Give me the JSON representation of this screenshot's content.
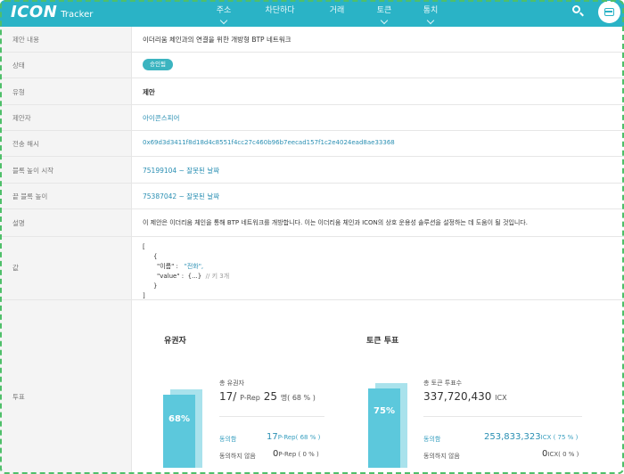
{
  "header": {
    "logo_main": "ICON",
    "logo_sub": "Tracker",
    "nav": [
      "주소",
      "차단하다",
      "거래",
      "토큰",
      "통치"
    ]
  },
  "rows": {
    "title": {
      "label": "제안 내용",
      "value": "이더리움 체인과의 연결을 위한 개방형 BTP 네트워크"
    },
    "status": {
      "label": "상태",
      "value": "승인됨"
    },
    "type": {
      "label": "유형",
      "value": "제안"
    },
    "proposer": {
      "label": "제안자",
      "value": "아이콘스피어"
    },
    "tx_hash": {
      "label": "전송 해시",
      "value": "0x69d3d3411f8d18d4c8551f4cc27c460b96b7eecad157f1c2e4024ead8ae33368"
    },
    "start_block": {
      "label": "블록 높이 시작",
      "value": "75199104",
      "suffix": " ~ 잘못된 날짜"
    },
    "end_block": {
      "label": "끝 블록 높이",
      "value": "75387042",
      "suffix": " ~ 잘못된 날짜"
    },
    "description": {
      "label": "설명",
      "value": "이 제안은 이더리움 체인을 통해 BTP 네트워크를 개방합니다. 이는 이더리움 체인과 ICON의 상호 운용성 솔루션을 설정하는 데 도움이 될 것입니다."
    },
    "value": {
      "label": "값",
      "open_bracket": "[",
      "open_brace": "{",
      "key1": "\"이름\" :",
      "val1": "\"전화\",",
      "key2": "\"value\" :",
      "val2": "{...}",
      "comment": "// 키 3개",
      "close_brace": "}",
      "close_bracket": "]"
    },
    "vote": {
      "label": "투표"
    }
  },
  "vote": {
    "voters": {
      "title": "유권자",
      "percent": "68%",
      "percent_value": 68,
      "total_label": "총 유권자",
      "total_count": "17/",
      "total_unit": "P-Rep",
      "total_of": "25",
      "total_suffix": "명( 68 % )",
      "agree_label": "동의함",
      "agree_num": "17",
      "agree_unit": "P-Rep( 68 % )",
      "disagree_label": "동의하지 않음",
      "disagree_num": "0",
      "disagree_unit": "P-Rep ( 0 % )"
    },
    "tokens": {
      "title": "토큰 투표",
      "percent": "75%",
      "percent_value": 75,
      "total_label": "총 토큰 투표수",
      "total_amount": "337,720,430",
      "total_unit": "ICX",
      "agree_label": "동의함",
      "agree_num": "253,833,323",
      "agree_unit": "ICX ( 75 % )",
      "disagree_label": "동의하지 않음",
      "disagree_num": "0",
      "disagree_unit": "ICX( 0 % )"
    }
  },
  "colors": {
    "brand": "#2ab3c6",
    "bar": "#5cc8dc",
    "link": "#2a8fb3",
    "frame": "#4fbf6a"
  }
}
